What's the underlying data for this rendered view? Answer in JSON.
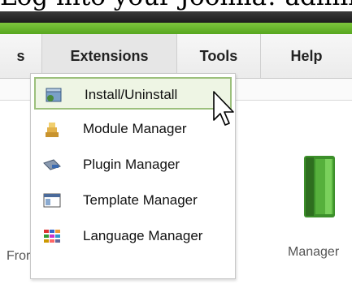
{
  "caption": "Log into your Joomla! administ",
  "menubar": {
    "items": [
      {
        "label": "s"
      },
      {
        "label": "Extensions"
      },
      {
        "label": "Tools"
      },
      {
        "label": "Help"
      }
    ]
  },
  "extensions_menu": {
    "items": [
      {
        "label": "Install/Uninstall",
        "icon": "install-icon",
        "highlighted": true
      },
      {
        "label": "Module Manager",
        "icon": "module-icon"
      },
      {
        "label": "Plugin Manager",
        "icon": "plugin-icon"
      },
      {
        "label": "Template Manager",
        "icon": "template-icon"
      },
      {
        "label": "Language Manager",
        "icon": "language-icon"
      }
    ]
  },
  "cpanel": {
    "left_label": "Fror",
    "right_label": "Manager"
  },
  "colors": {
    "accent_green": "#6bb52e",
    "highlight_border": "#9cc07c",
    "highlight_bg": "#eef5e4"
  }
}
